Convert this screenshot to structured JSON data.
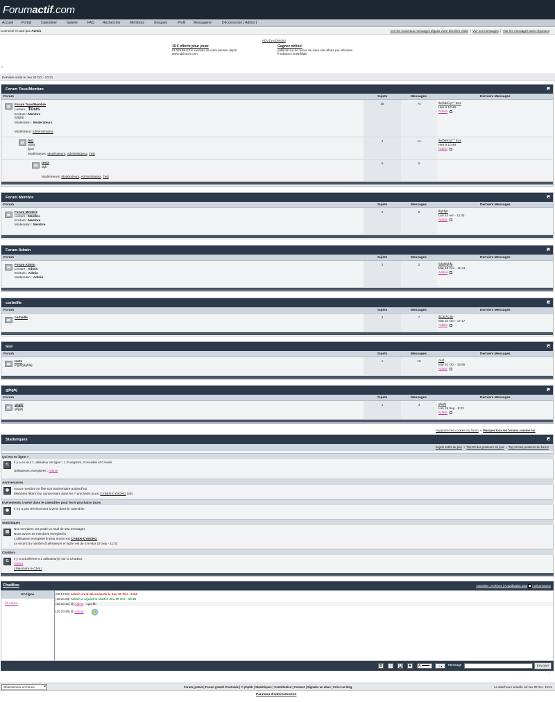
{
  "header": {
    "logo_light": "Forum",
    "logo_bold": "actif",
    ".com": ".com",
    "logo_domain": ".com"
  },
  "nav": [
    "Accueil",
    "Portail",
    "Calendrier",
    "Galerie",
    "FAQ",
    "Rechercher",
    "Membres",
    "Groupes",
    "Profil",
    "Messagerie",
    "Déconnexion [ Admin ]"
  ],
  "subbar": {
    "connected_prefix": "Connecté en tant que ",
    "connected_user": "Admin",
    "connected_suffix": ".",
    "links": [
      "Voir les nouveaux messages depuis votre dernière visite",
      "Voir ses messages",
      "Voir les messages sans réponses"
    ]
  },
  "ad": {
    "label": "ADV by eDintorni",
    "left_title": "10 € offerts pour jouer",
    "left_line1": "Et DOUBLEZ le montant de votre premier dépôt",
    "left_line2": "www.ubiinmer.com",
    "right_title": "Gagnez online!",
    "right_line1": "publicité sur les textes de votre site offerte par eDintorni",
    "right_line2": "fr.edintorni.net/affiliati/"
  },
  "breadcrumb_arrow": "»",
  "last_visit": "Dernière visite le Jeu 30 Oct - 10:21",
  "columns": {
    "forum": "Forum",
    "topics": "Sujets",
    "posts": "Messages",
    "last": "Derniers Messages"
  },
  "categories": [
    {
      "title": "Forum Tous/Membre",
      "forums": [
        {
          "name": "Forum Tous/Membre",
          "lecture_label": "Lecture : ",
          "lecture_value": "Tous",
          "ecriture_label": "Ecriture : ",
          "ecriture_value": "Membre",
          "extra": "ÉÏÉÊÉ",
          "moderation_label": "Moderation : ",
          "moderation_value": "Moderateurs",
          "moderators_label": "Modérateur: ",
          "moderators": [
            "Administrateur"
          ],
          "topics": "25",
          "posts": "74",
          "last_title": "ãeÕæÜ p°° Eus",
          "last_date": "Hier à 10:49",
          "last_user": "Admin"
        },
        {
          "name": "test",
          "line1": "dfdfg",
          "line2": "lgrai",
          "moderators_label": "Modérateurs: ",
          "moderators": [
            "Modérateurs",
            "Administrateur",
            "Test"
          ],
          "topics": "2",
          "posts": "14",
          "last_title": "ãeÕæÜ p°° Eus",
          "last_date": "Hier à 10:49",
          "last_user": "Admin"
        },
        {
          "name": "test2",
          "line1": "dgb",
          "moderators_label": "Modérateurs: ",
          "moderators": [
            "Modérateurs",
            "Administrateur",
            "Test"
          ],
          "topics": "0",
          "posts": "0"
        }
      ]
    },
    {
      "title": "Forum Membre",
      "forums": [
        {
          "name": "Forum Membre",
          "lecture_label": "Lecture : ",
          "lecture_value": "Membre",
          "ecriture_label": "Ecriture : ",
          "ecriture_value": "Membre",
          "moderation_label": "Moderation : ",
          "moderation_value": "Membre",
          "topics": "2",
          "posts": "6",
          "last_title": "ffghfgh",
          "last_date": "Lun 14 Avr - 14:43",
          "last_user": "Admin"
        }
      ]
    },
    {
      "title": "Forum Admin",
      "forums": [
        {
          "name": "Forum Admin",
          "lecture_label": "Lecture : ",
          "lecture_value": "Admin",
          "ecriture_label": "Ecriture : ",
          "ecriture_value": "Admin",
          "moderation_label": "Moderation : ",
          "moderation_value": "Admin",
          "topics": "2",
          "posts": "2",
          "last_title": "fgfghfghfg",
          "last_date": "Mar 19 Fév - 11:41",
          "last_user": "Admin"
        }
      ]
    },
    {
      "title": "corbeille",
      "forums": [
        {
          "name": "corbeille",
          "topics": "4",
          "posts": "7",
          "last_title": "ãCIÉÀCIÉ",
          "last_date": "Mar 21 Oct - 17:17",
          "last_user": "Admin"
        }
      ]
    },
    {
      "title": "test",
      "forums": [
        {
          "name": "test1",
          "line1": "fdgdfgdgfdfg",
          "topics": "1",
          "posts": "10",
          "last_title": "cssf",
          "last_date": "Mar 21 Oct - 16:55",
          "last_user": "Admin"
        }
      ]
    },
    {
      "title": "gjhghj",
      "forums": [
        {
          "name": "ghghj",
          "line1": "ghjghj",
          "topics": "1",
          "posts": "3",
          "last_title": "ghghj",
          "last_date": "Lun 15 Sep - 8:23",
          "last_user": "Admin"
        }
      ]
    }
  ],
  "cookies": {
    "delete": "Supprimer les cookies du forum",
    "mark_read": "Marquer tous les forums comme lus"
  },
  "stats": {
    "title": "Statistiques",
    "links": [
      "Sujets actifs du jour",
      "Top 20 des posteurs du jour",
      "Top 20 des posteurs du forum"
    ],
    "sections": [
      {
        "title": "Qui est en ligne ?",
        "icon": "f1",
        "lines": [
          "Il y a en tout 1 utilisateur en ligne :: 1 Enregistré, 0 Invisible et 0 Invité",
          "Utilisateurs enregistrés : "
        ],
        "user": "Admin"
      },
      {
        "title": "Anniversaires",
        "icon": "birthday-icon",
        "lines": [
          "Aucun membre ne fête son anniversaire aujourd'hui",
          "Membres fêtant leur anniversaire dans les 7 prochains jours: "
        ],
        "bday_user": "CYBER-CYBORG",
        "bday_age": " (25)"
      },
      {
        "title": "Evénements à venir dans le calendrier pour les 5 prochains jours",
        "icon": "calendar-icon",
        "lines": [
          "Il n'y a pas d'événement à venir dans le calendrier"
        ]
      },
      {
        "title": "Statistiques",
        "icon": "stats-icon",
        "lines": [
          "Nos membres ont posté un total de 102 messages",
          "Nous avons 19 membres enregistrés",
          "L'utilisateur enregistré le plus récent est ",
          "Le record du nombre d'utilisateurs en ligne est de 4 le Mar 24 Sep - 11:02"
        ],
        "newest_user": "CYBER-CYBORG"
      },
      {
        "title": "ChatBox",
        "icon": "f1",
        "lines": [
          "Il y a actuellement 1 utilisateur(s) sur la ChatBox"
        ],
        "user": "Admin",
        "join": "[ Rejoindre le Chat ]"
      }
    ]
  },
  "chatbox": {
    "title": "ChatBox",
    "actions": "Actualiser | Archives | Actualisation auto",
    "disconnect": "| Déconnexion",
    "online_header": "En ligne",
    "online_user": "@ Admin",
    "messages": [
      {
        "time": "[09:54:52]",
        "text": "Admin s'est déconnecté le Jeu 30 Oct - 9:54",
        "color": "#e02020"
      },
      {
        "time": "[10:20:33]",
        "text": "Admin a rejoint le chat le Jeu 30 Oct - 10:20",
        "color": "#1f9a3a"
      },
      {
        "time": "[10:20:41]",
        "user": "Admin",
        "text": " : cgcvbb"
      },
      {
        "time": "[10:20:46]",
        "user": "Admin",
        "text": " : "
      }
    ],
    "toolbar": {
      "bold": "B",
      "italic": "I",
      "underline": "U",
      "strike": "S",
      "font": "A",
      "message_label": "Message",
      "send": "Envoyer"
    }
  },
  "footer": {
    "select": "Sélectionner un forum",
    "links": "Forum gratuit | Forum gratuit d'entraide | © phpbb | Statistiques | Contribution | Contact | Signaler un abus | Créer un blog",
    "time": "La date/heure actuelle est Jeu 30 Oct - 10:21",
    "admin_panel": "Panneau d'administration"
  }
}
